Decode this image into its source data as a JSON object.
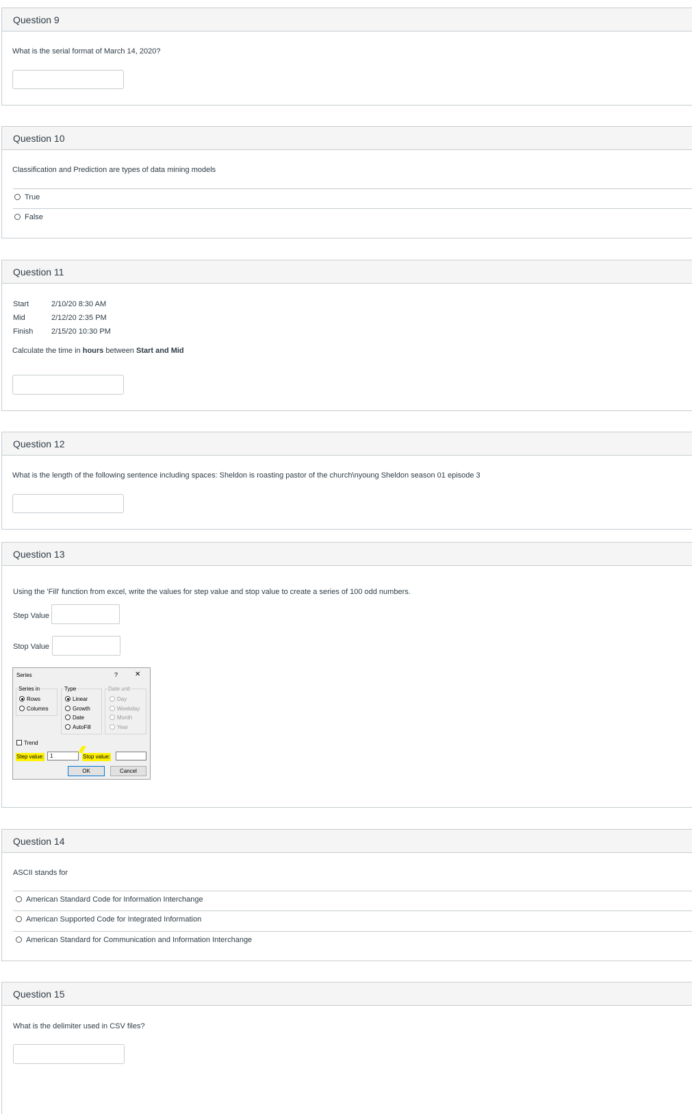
{
  "q9": {
    "title": "Question 9",
    "prompt": "What is the serial format of March 14, 2020?"
  },
  "q10": {
    "title": "Question 10",
    "prompt": "Classification and Prediction are types of data mining models",
    "options": [
      "True",
      "False"
    ]
  },
  "q11": {
    "title": "Question 11",
    "rows": [
      {
        "label": "Start",
        "value": "2/10/20 8:30 AM"
      },
      {
        "label": "Mid",
        "value": "2/12/20 2:35 PM"
      },
      {
        "label": "Finish",
        "value": "2/15/20 10:30 PM"
      }
    ],
    "prompt_pre": "Calculate the time in ",
    "prompt_bold1": "hours",
    "prompt_mid": " between ",
    "prompt_bold2": "Start and Mid"
  },
  "q12": {
    "title": "Question 12",
    "prompt": "What is the length of the following sentence including spaces: Sheldon is roasting pastor of the church\\nyoung Sheldon season 01 episode 3"
  },
  "q13": {
    "title": "Question 13",
    "prompt": "Using the 'Fill' function from excel, write the values for step value and stop value to create a series of 100 odd numbers.",
    "step_label": "Step Value",
    "stop_label": "Stop Value",
    "dialog": {
      "title": "Series",
      "help": "?",
      "close": "✕",
      "series_in_label": "Series in",
      "series_in_options": [
        "Rows",
        "Columns"
      ],
      "type_label": "Type",
      "type_options": [
        "Linear",
        "Growth",
        "Date",
        "AutoFill"
      ],
      "date_unit_label": "Date unit",
      "date_unit_options": [
        "Day",
        "Weekday",
        "Month",
        "Year"
      ],
      "trend_label": "Trend",
      "step_value_label": "Step value:",
      "step_value": "1",
      "stop_value_label": "Stop value:",
      "ok": "OK",
      "cancel": "Cancel",
      "highlight_color": "#fff200"
    }
  },
  "q14": {
    "title": "Question 14",
    "prompt": "ASCII stands for",
    "options": [
      "American Standard Code for Information Interchange",
      "American Supported Code for Integrated Information",
      "American Standard for Communication and Information Interchange"
    ]
  },
  "q15": {
    "title": "Question 15",
    "prompt": "What is the delimiter used in CSV files?"
  }
}
